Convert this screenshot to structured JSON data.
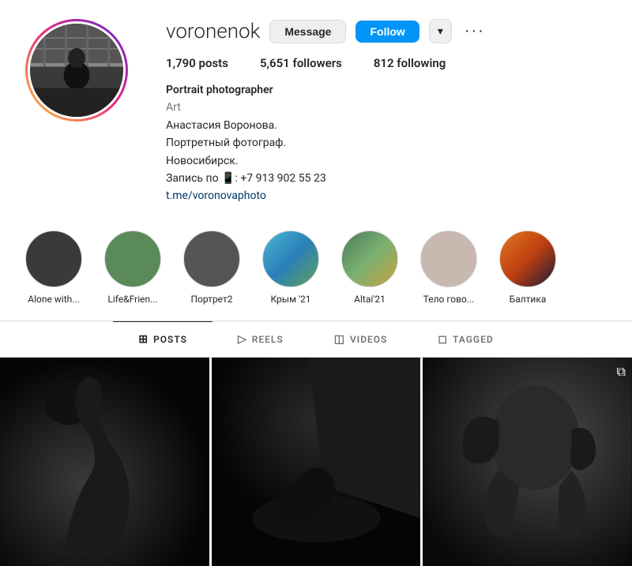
{
  "profile": {
    "username": "voronenok",
    "stats": {
      "posts_count": "1,790",
      "posts_label": "posts",
      "followers_count": "5,651",
      "followers_label": "followers",
      "following_count": "812",
      "following_label": "following"
    },
    "bio": {
      "name": "Portrait photographer",
      "category": "Art",
      "line1": "Анастасия Воронова.",
      "line2": "Портретный фотограф.",
      "line3": "Новосибирск.",
      "line4": "Запись по 📱: +7 913 902 55 23",
      "link_text": "t.me/voronovaphoto",
      "link_href": "https://t.me/voronovaphoto"
    },
    "buttons": {
      "message": "Message",
      "follow": "Follow",
      "more": "···"
    }
  },
  "stories": [
    {
      "label": "Alone with...",
      "color_class": "story-0"
    },
    {
      "label": "Life&Frien...",
      "color_class": "story-1"
    },
    {
      "label": "Портрет2",
      "color_class": "story-2"
    },
    {
      "label": "Крым '21",
      "color_class": "story-3"
    },
    {
      "label": "Altai'21",
      "color_class": "story-4"
    },
    {
      "label": "Тело гово...",
      "color_class": "story-5"
    },
    {
      "label": "Балтика",
      "color_class": "story-6"
    }
  ],
  "tabs": [
    {
      "id": "posts",
      "label": "POSTS",
      "icon": "⊞",
      "active": true
    },
    {
      "id": "reels",
      "label": "REELS",
      "icon": "▷",
      "active": false
    },
    {
      "id": "videos",
      "label": "VIDEOS",
      "icon": "◫",
      "active": false
    },
    {
      "id": "tagged",
      "label": "TAGGED",
      "icon": "◻",
      "active": false
    }
  ],
  "posts": [
    {
      "id": 1,
      "type": "bw_portrait",
      "multi": false
    },
    {
      "id": 2,
      "type": "bw_figure",
      "multi": false
    },
    {
      "id": 3,
      "type": "bw_hair",
      "multi": true
    }
  ],
  "colors": {
    "follow_btn": "#0095f6",
    "active_tab_border": "#262626"
  }
}
